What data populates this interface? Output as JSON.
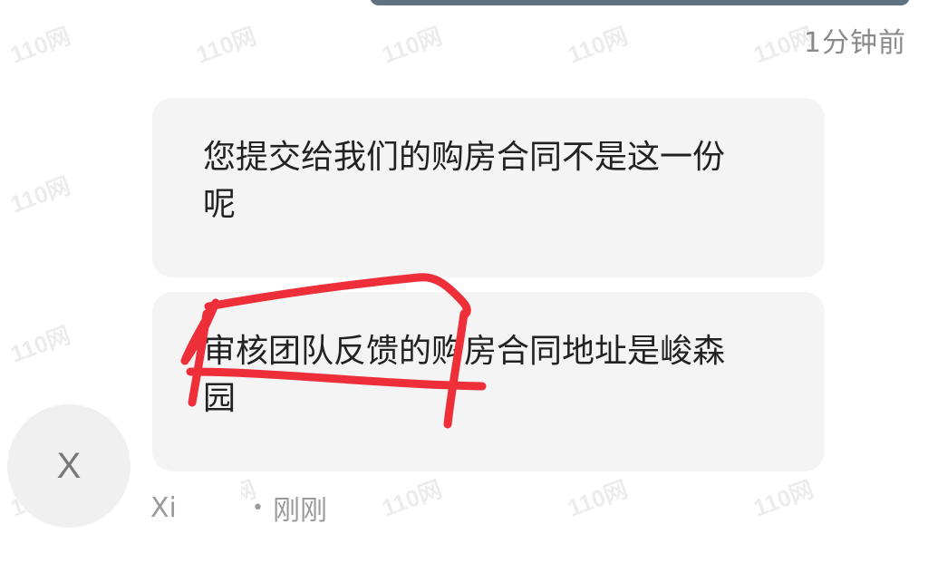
{
  "conversation": {
    "top_timestamp": "1分钟前",
    "messages": [
      {
        "text": "您提交给我们的购房合同不是这一份呢"
      },
      {
        "text": "审核团队反馈的购房合同地址是峻森园"
      }
    ],
    "sender": {
      "avatar_letter": "X",
      "name_visible": "Xi",
      "separator": "•",
      "time": "刚刚"
    }
  },
  "watermark": {
    "text": "110网"
  },
  "colors": {
    "bubble_bg": "#f4f4f4",
    "avatar_bg": "#f0f0f0",
    "annotation": "#ee2f3a",
    "top_bar": "#607181",
    "meta_text": "#9a9a9a"
  }
}
